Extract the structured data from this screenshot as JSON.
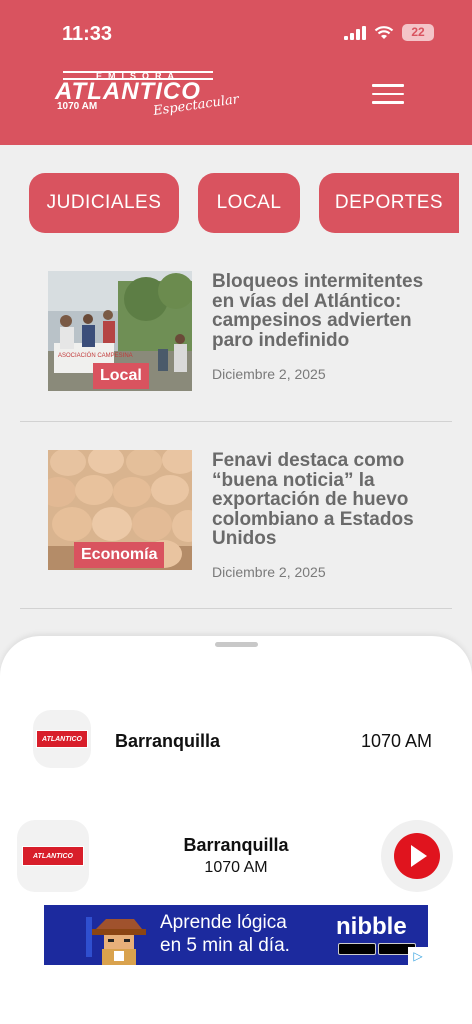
{
  "status_bar": {
    "time": "11:33",
    "battery": "22"
  },
  "header": {
    "logo_top": "EMISORA",
    "logo_main": "ATLANTICO",
    "logo_am": "1070 AM",
    "logo_script": "Espectacular"
  },
  "categories": [
    {
      "label": "JUDICIALES"
    },
    {
      "label": "LOCAL"
    },
    {
      "label": "DEPORTES"
    }
  ],
  "articles": [
    {
      "title": "Bloqueos intermitentes en vías del Atlántico: campesinos advierten paro indefinido",
      "date": "Diciembre 2, 2025",
      "category": "Local"
    },
    {
      "title": "Fenavi destaca como “buena noticia” la exportación de huevo colombiano a Estados Unidos",
      "date": "Diciembre 2, 2025",
      "category": "Economía"
    }
  ],
  "player": {
    "station_list_name": "Barranquilla",
    "station_list_freq": "1070 AM",
    "now_playing_name": "Barranquilla",
    "now_playing_freq": "1070 AM",
    "mini_logo_text": "ATLANTICO"
  },
  "ad": {
    "line1": "Aprende lógica",
    "line2": "en 5 min al día.",
    "brand": "nibble"
  }
}
